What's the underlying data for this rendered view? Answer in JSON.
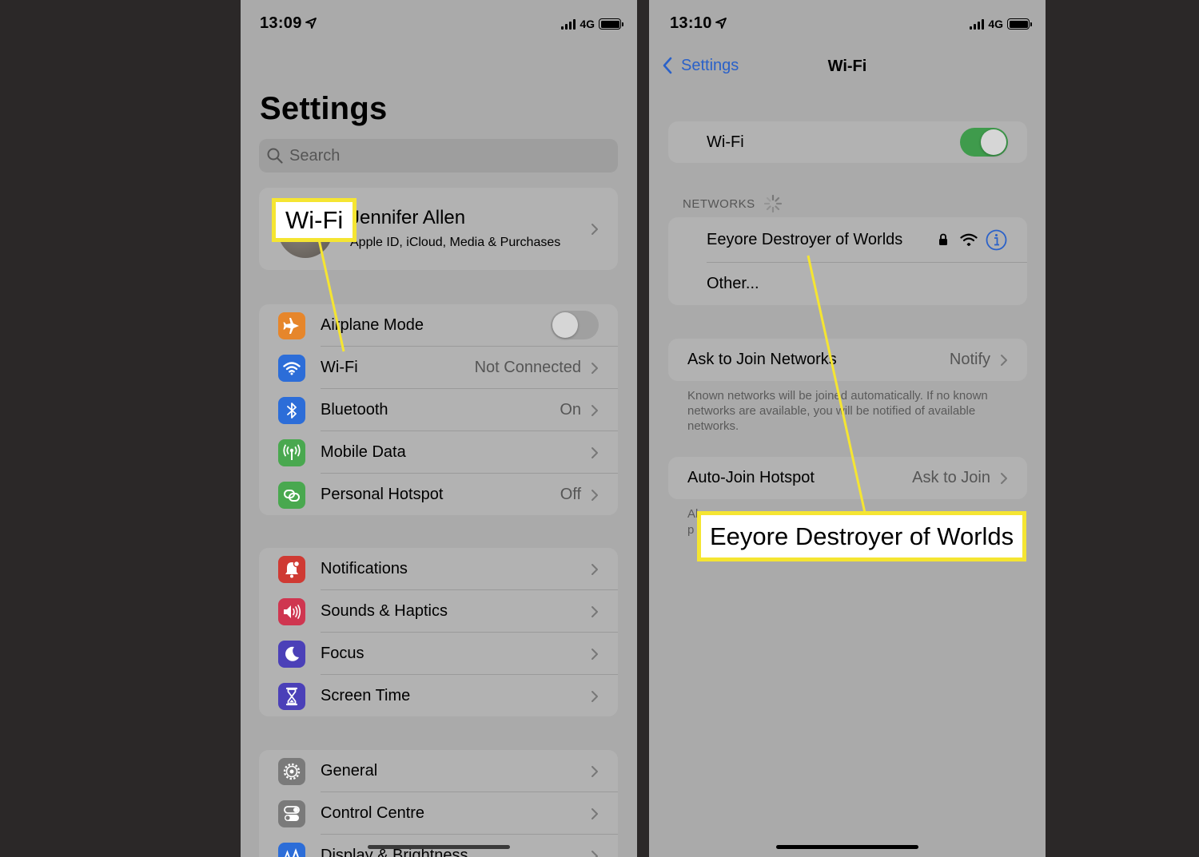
{
  "colors": {
    "backdrop": "#2b2828",
    "screen_bg": "#aaaaaa",
    "card_bg": "#b2b2b2",
    "highlight": "#f5e532",
    "link_blue": "#2a61c9",
    "toggle_on": "#3f9b4c"
  },
  "left": {
    "status": {
      "time": "13:09",
      "network": "4G"
    },
    "title": "Settings",
    "search": {
      "placeholder": "Search",
      "icon": "magnifier"
    },
    "profile": {
      "name": "Jennifer Allen",
      "subtitle": "Apple ID, iCloud, Media & Purchases"
    },
    "group1": [
      {
        "label": "Airplane Mode",
        "icon": "airplane",
        "color": "#e6862b",
        "toggle": "off"
      },
      {
        "label": "Wi-Fi",
        "value": "Not Connected",
        "icon": "wifi",
        "color": "#2c6dd8"
      },
      {
        "label": "Bluetooth",
        "value": "On",
        "icon": "bluetooth",
        "color": "#2c6dd8"
      },
      {
        "label": "Mobile Data",
        "value": "",
        "icon": "antenna",
        "color": "#49a84f"
      },
      {
        "label": "Personal Hotspot",
        "value": "Off",
        "icon": "chain-link",
        "color": "#49a84f"
      }
    ],
    "group2": [
      {
        "label": "Notifications",
        "icon": "bell",
        "color": "#cf3a33"
      },
      {
        "label": "Sounds & Haptics",
        "icon": "speaker",
        "color": "#cf3650"
      },
      {
        "label": "Focus",
        "icon": "moon",
        "color": "#4b40b8"
      },
      {
        "label": "Screen Time",
        "icon": "hourglass",
        "color": "#4b40b8"
      }
    ],
    "group3": [
      {
        "label": "General",
        "icon": "gear",
        "color": "#7a7a7a"
      },
      {
        "label": "Control Centre",
        "icon": "switches",
        "color": "#7a7a7a"
      },
      {
        "label": "Display & Brightness",
        "icon": "text-size",
        "color": "#2c6dd8"
      }
    ],
    "callout": "Wi-Fi"
  },
  "right": {
    "status": {
      "time": "13:10",
      "network": "4G"
    },
    "nav": {
      "back": "Settings",
      "title": "Wi-Fi"
    },
    "wifi_toggle": {
      "label": "Wi-Fi",
      "state": "on"
    },
    "networks_header": "NETWORKS",
    "networks": [
      {
        "name": "Eeyore Destroyer of Worlds",
        "secured": true
      },
      {
        "name": "Other..."
      }
    ],
    "ask_join": {
      "label": "Ask to Join Networks",
      "value": "Notify"
    },
    "ask_join_note": "Known networks will be joined automatically. If no known networks are available, you will be notified of available networks.",
    "auto_join": {
      "label": "Auto-Join Hotspot",
      "value": "Ask to Join"
    },
    "auto_join_note_fragment": "Al",
    "auto_join_note_fragment2": "p",
    "callout": "Eeyore Destroyer of Worlds"
  }
}
